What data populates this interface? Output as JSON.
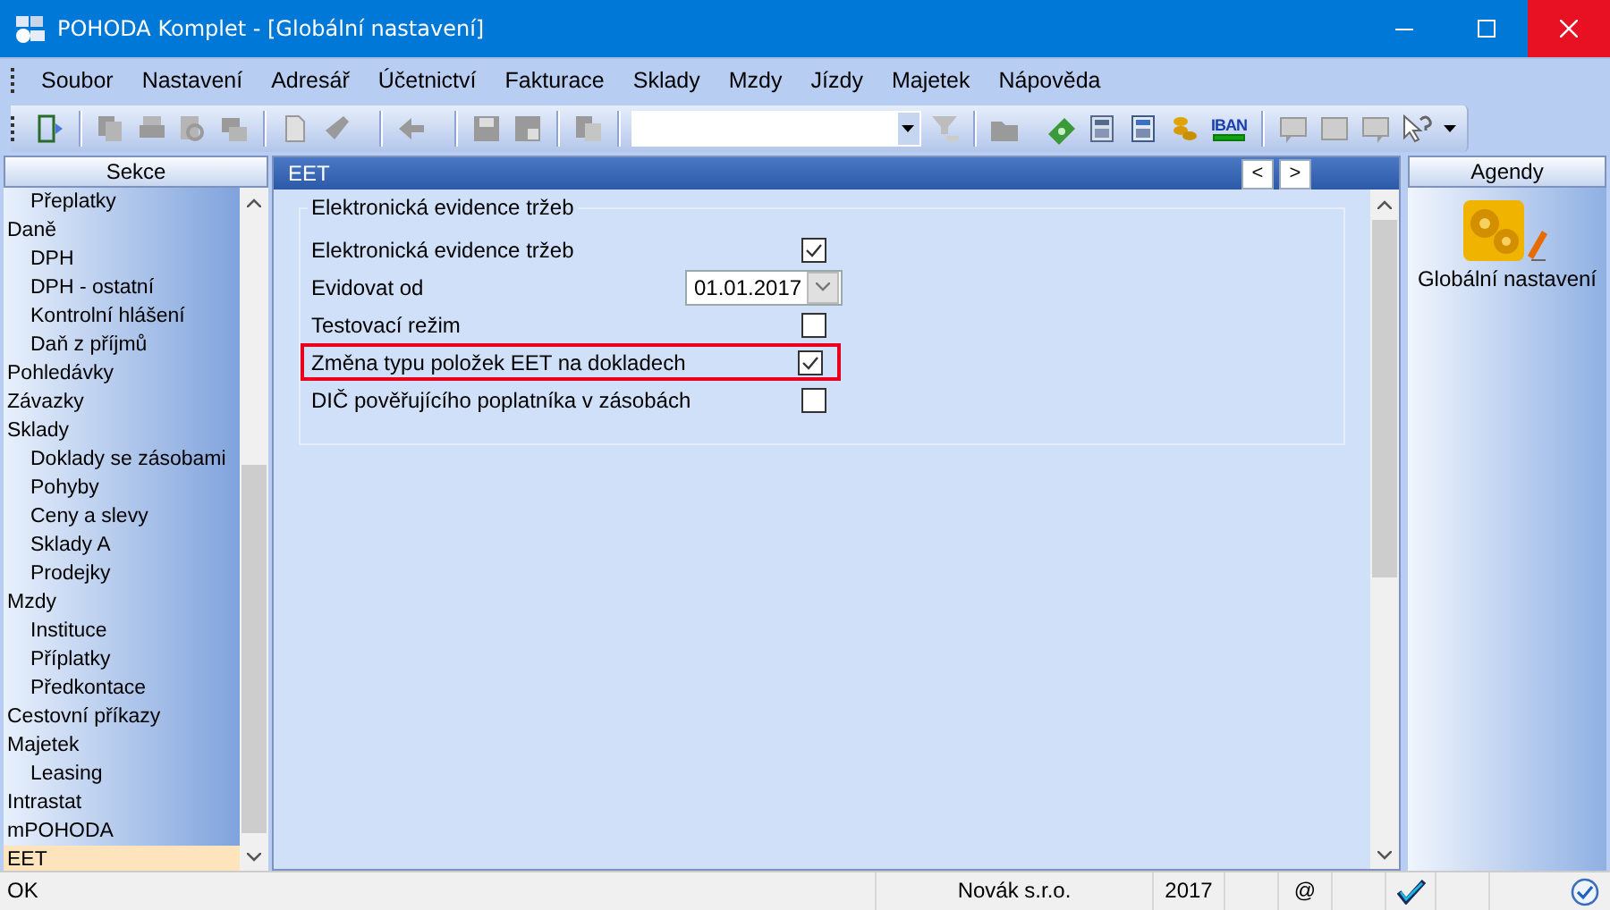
{
  "window": {
    "title": "POHODA Komplet - [Globální nastavení]"
  },
  "menu": [
    "Soubor",
    "Nastavení",
    "Adresář",
    "Účetnictví",
    "Fakturace",
    "Sklady",
    "Mzdy",
    "Jízdy",
    "Majetek",
    "Nápověda"
  ],
  "toolbar": {
    "iban_label": "IBAN"
  },
  "sidebar": {
    "title": "Sekce",
    "items": [
      {
        "children": [
          {
            "label": "Přeplatky",
            "selected": false
          }
        ]
      },
      {
        "label": "Daně",
        "selected": false,
        "children": [
          {
            "label": "DPH",
            "selected": false
          },
          {
            "label": "DPH - ostatní",
            "selected": false
          },
          {
            "label": "Kontrolní hlášení",
            "selected": false
          },
          {
            "label": "Daň z příjmů",
            "selected": false
          }
        ]
      },
      {
        "label": "Pohledávky",
        "selected": false
      },
      {
        "label": "Závazky",
        "selected": false
      },
      {
        "label": "Sklady",
        "selected": false,
        "children": [
          {
            "label": "Doklady se zásobami",
            "selected": false
          },
          {
            "label": "Pohyby",
            "selected": false
          },
          {
            "label": "Ceny a slevy",
            "selected": false
          },
          {
            "label": "Sklady A",
            "selected": false
          },
          {
            "label": "Prodejky",
            "selected": false
          }
        ]
      },
      {
        "label": "Mzdy",
        "selected": false,
        "children": [
          {
            "label": "Instituce",
            "selected": false
          },
          {
            "label": "Příplatky",
            "selected": false
          },
          {
            "label": "Předkontace",
            "selected": false
          }
        ]
      },
      {
        "label": "Cestovní příkazy",
        "selected": false
      },
      {
        "label": "Majetek",
        "selected": false,
        "children": [
          {
            "label": "Leasing",
            "selected": false
          }
        ]
      },
      {
        "label": "Intrastat",
        "selected": false
      },
      {
        "label": "mPOHODA",
        "selected": false
      },
      {
        "label": "EET",
        "selected": true
      }
    ]
  },
  "panel": {
    "title": "EET",
    "nav_prev": "<",
    "nav_next": ">",
    "group_title": "Elektronická evidence tržeb",
    "options": [
      {
        "kind": "checkbox",
        "label": "Elektronická evidence tržeb",
        "checked": true,
        "highlighted": false
      },
      {
        "kind": "date",
        "label": "Evidovat od",
        "value": "01.01.2017",
        "highlighted": false
      },
      {
        "kind": "checkbox",
        "label": "Testovací režim",
        "checked": false,
        "highlighted": false
      },
      {
        "kind": "checkbox",
        "label": "Změna typu položek EET na dokladech",
        "checked": true,
        "highlighted": true
      },
      {
        "kind": "checkbox",
        "label": "DIČ pověřujícího poplatníka v zásobách",
        "checked": false,
        "highlighted": false
      }
    ]
  },
  "agendy": {
    "title": "Agendy",
    "items": [
      {
        "label": "Globální nastavení"
      }
    ]
  },
  "status_bar": {
    "message": "OK",
    "company": "Novák s.r.o.",
    "year": "2017",
    "email": "@"
  }
}
